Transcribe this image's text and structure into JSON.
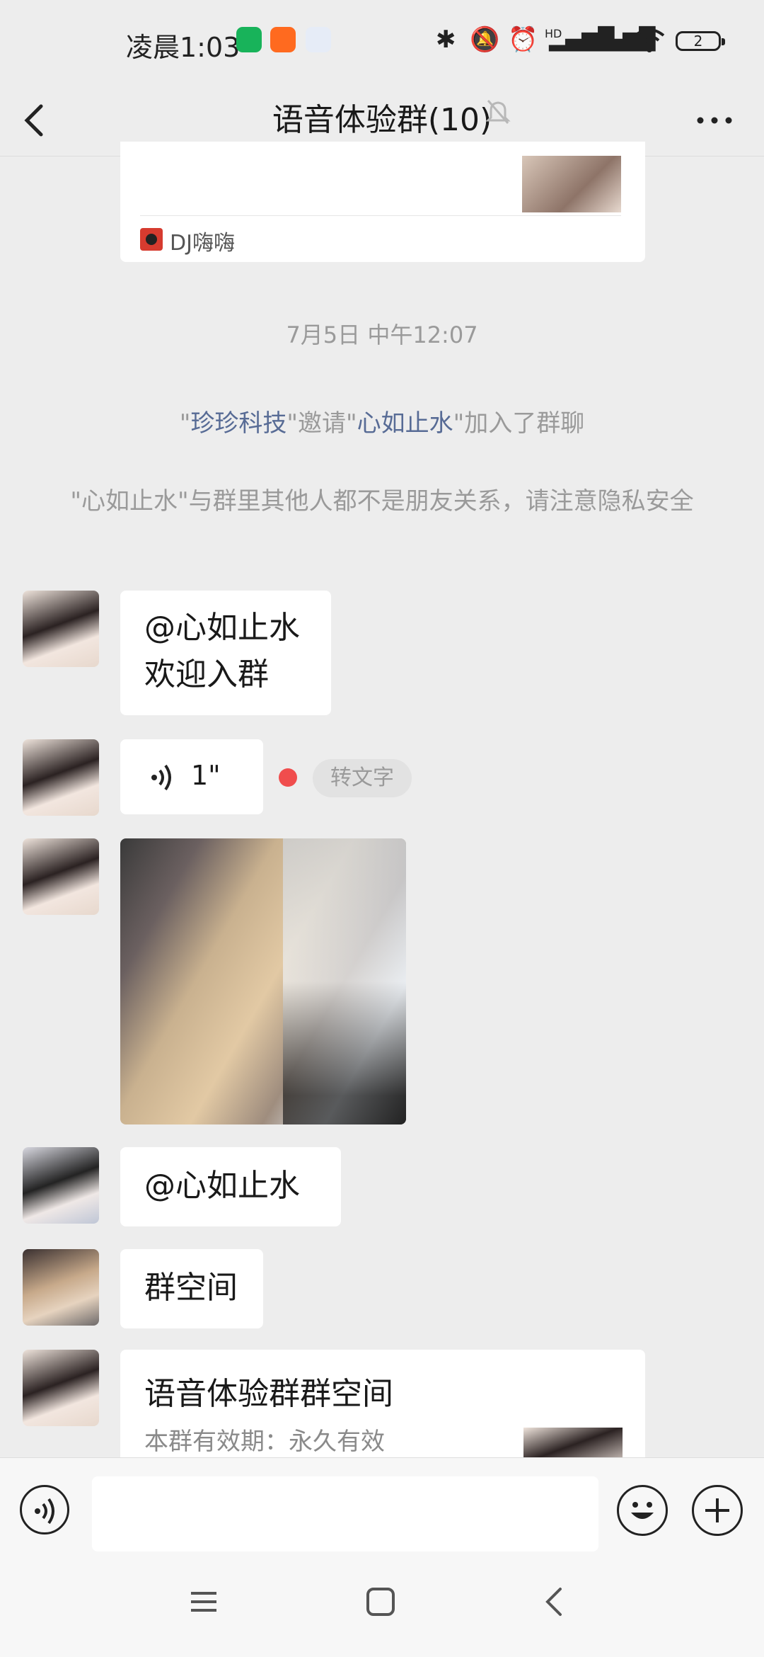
{
  "status_bar": {
    "time": "凌晨1:03",
    "battery": "2",
    "signal_label": "HD"
  },
  "header": {
    "title": "语音体验群(10)",
    "back_icon": "chevron-left-icon",
    "mute_icon": "bell-off-icon",
    "more_icon": "ellipsis-icon"
  },
  "messages": {
    "music_card_source": "DJ嗨嗨",
    "timestamp": "7月5日 中午12:07",
    "invite": {
      "q1": "\"",
      "inviter": "珍珍科技",
      "mid": "\"邀请\"",
      "invitee": "心如止水",
      "tail": "\"加入了群聊"
    },
    "privacy_notice": "\"心如止水\"与群里其他人都不是朋友关系，请注意隐私安全",
    "text_msg_1_line1": "@心如止水",
    "text_msg_1_line2": "欢迎入群",
    "voice_duration": "1\"",
    "voice_to_text": "转文字",
    "text_msg_2": "@心如止水",
    "text_msg_3": "群空间",
    "group_space_card": {
      "title": "语音体验群群空间",
      "subtitle": "本群有效期：永久有效"
    }
  },
  "colors": {
    "background": "#ededed",
    "bubble": "#ffffff",
    "highlight": "#576b95",
    "unread_dot": "#f04d4d"
  }
}
